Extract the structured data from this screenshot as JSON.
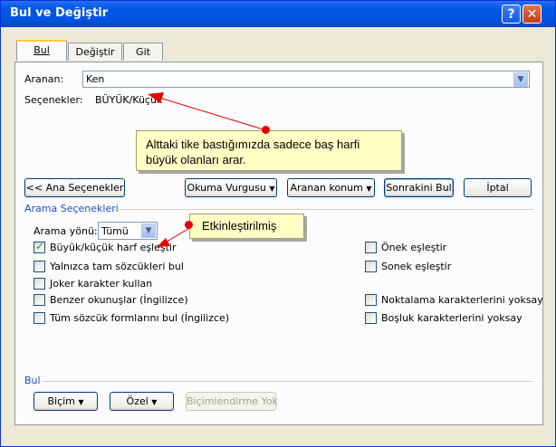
{
  "window": {
    "title": "Bul ve Değiştir",
    "help_label": "?",
    "close_label": "✕"
  },
  "tabs": [
    {
      "label": "Bul"
    },
    {
      "label": "Değiştir"
    },
    {
      "label": "Git"
    }
  ],
  "search": {
    "label": "Aranan:",
    "value": "Ken"
  },
  "options": {
    "label": "Seçenekler:",
    "value": "BÜYÜK/Küçük"
  },
  "callout_top": {
    "text": "Alttaki tike bastığımızda sadece baş harfi büyük olanları arar."
  },
  "callout_active": {
    "text": "Etkinleştirilmiş"
  },
  "buttons": {
    "less_options": "<< Ana Seçenekler",
    "reading_highlight": "Okuma Vurgusu",
    "find_in": "Aranan konum",
    "find_next": "Sonrakini Bul",
    "cancel": "İptal"
  },
  "search_options": {
    "section_title": "Arama Seçenekleri",
    "direction_label": "Arama yönü:",
    "direction_value": "Tümü",
    "left": [
      {
        "label": "Büyük/küçük harf eşleştir",
        "checked": true
      },
      {
        "label": "Yalnızca tam sözcükleri bul",
        "checked": false
      },
      {
        "label": "Joker karakter kullan",
        "checked": false
      },
      {
        "label": "Benzer okunuşlar (İngilizce)",
        "checked": false
      },
      {
        "label": "Tüm sözcük formlarını bul (İngilizce)",
        "checked": false
      }
    ],
    "right": [
      {
        "label": "Önek eşleştir",
        "checked": false
      },
      {
        "label": "Sonek eşleştir",
        "checked": false
      },
      {
        "label": "Noktalama karakterlerini yoksay",
        "checked": false
      },
      {
        "label": "Boşluk karakterlerini yoksay",
        "checked": false
      }
    ]
  },
  "find_section": {
    "title": "Bul",
    "format_button": "Biçim",
    "special_button": "Özel",
    "no_formatting_button": "Biçimlendirme Yok"
  },
  "colors": {
    "titlebar": "#0054e3",
    "section_text": "#1b4ec6",
    "arrow": "#e80000",
    "note_bg": "#ffffc6"
  },
  "icons": {
    "dropdown": "chevron-down-icon",
    "help": "help-icon",
    "close": "close-icon",
    "check": "check-icon"
  }
}
